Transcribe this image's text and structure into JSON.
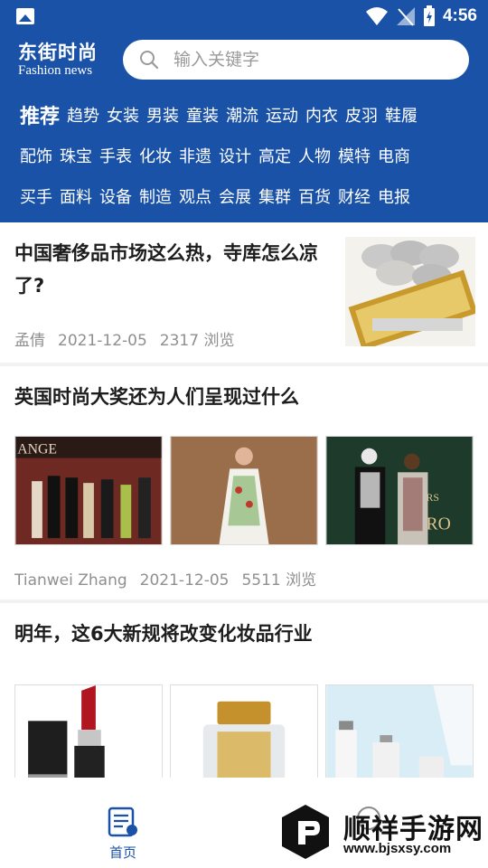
{
  "status_bar": {
    "time": "4:56"
  },
  "header": {
    "logo_cn": "东街时尚",
    "logo_en": "Fashion news",
    "search_placeholder": "输入关键字",
    "categories": [
      [
        "推荐",
        "趋势",
        "女装",
        "男装",
        "童装",
        "潮流",
        "运动",
        "内衣",
        "皮羽",
        "鞋履"
      ],
      [
        "配饰",
        "珠宝",
        "手表",
        "化妆",
        "非遗",
        "设计",
        "高定",
        "人物",
        "模特",
        "电商"
      ],
      [
        "买手",
        "面料",
        "设备",
        "制造",
        "观点",
        "会展",
        "集群",
        "百货",
        "财经",
        "电报"
      ]
    ],
    "active_category": "推荐"
  },
  "articles": [
    {
      "title": "中国奢侈品市场这么热，寺库怎么凉了?",
      "author": "孟倩",
      "date": "2021-12-05",
      "views": "2317 浏览"
    },
    {
      "title": "英国时尚大奖还为人们呈现过什么",
      "author": "Tianwei Zhang",
      "date": "2021-12-05",
      "views": "5511 浏览"
    },
    {
      "title": "明年，这6大新规将改变化妆品行业"
    }
  ],
  "bottom_nav": {
    "home_label": "首页"
  },
  "watermark": {
    "title": "顺祥手游网",
    "url": "www.bjsxsy.com"
  },
  "colors": {
    "brand": "#1a52a8",
    "text": "#1d1d1d",
    "meta": "#8f8f8f"
  }
}
